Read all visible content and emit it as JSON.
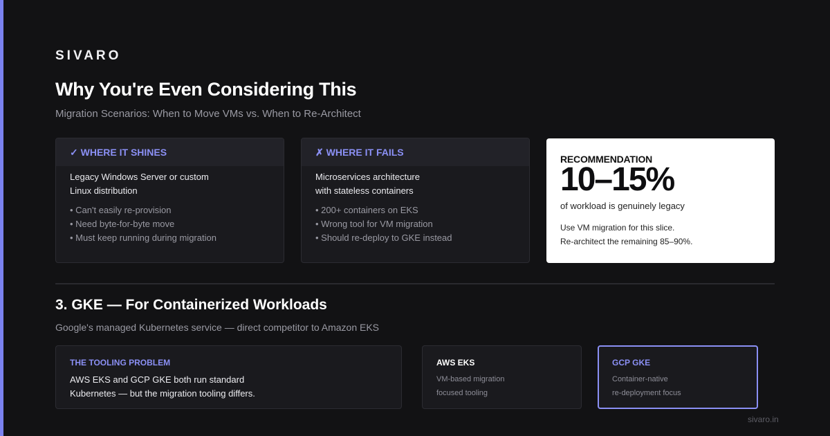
{
  "brand": "SIVARO",
  "title": "Why You're Even Considering This",
  "subtitle": "Migration Scenarios: When to Move VMs vs. When to Re-Architect",
  "colors": {
    "accent": "#8b90f5",
    "background": "#121214",
    "card": "#1a1a1e",
    "recommendation_bg": "#ffffff"
  },
  "shines": {
    "icon": "checkmark-icon",
    "heading": "✓ WHERE IT SHINES",
    "lead": [
      "Legacy Windows Server or custom",
      "Linux distribution"
    ],
    "bullets": [
      "• Can't easily re-provision",
      "• Need byte-for-byte move",
      "• Must keep running during migration"
    ]
  },
  "fails": {
    "icon": "cross-icon",
    "heading": "✗ WHERE IT FAILS",
    "lead": [
      "Microservices architecture",
      "with stateless containers"
    ],
    "bullets": [
      "• 200+ containers on EKS",
      "• Wrong tool for VM migration",
      "• Should re-deploy to GKE instead"
    ]
  },
  "recommendation": {
    "label": "RECOMMENDATION",
    "big": "10–15%",
    "desc": "of workload is genuinely legacy",
    "note": [
      "Use VM migration for this slice.",
      "Re-architect the remaining 85–90%."
    ]
  },
  "section": {
    "title": "3. GKE — For Containerized Workloads",
    "subtitle": "Google's managed Kubernetes service — direct competitor to Amazon EKS"
  },
  "tooling": {
    "heading": "THE TOOLING PROBLEM",
    "body": [
      "AWS EKS and GCP GKE both run standard",
      "Kubernetes — but the migration tooling differs."
    ]
  },
  "aws": {
    "heading": "AWS EKS",
    "body": [
      "VM-based migration",
      "focused tooling"
    ]
  },
  "gcp": {
    "heading": "GCP GKE",
    "body": [
      "Container-native",
      "re-deployment focus"
    ]
  },
  "footer": "sivaro.in"
}
